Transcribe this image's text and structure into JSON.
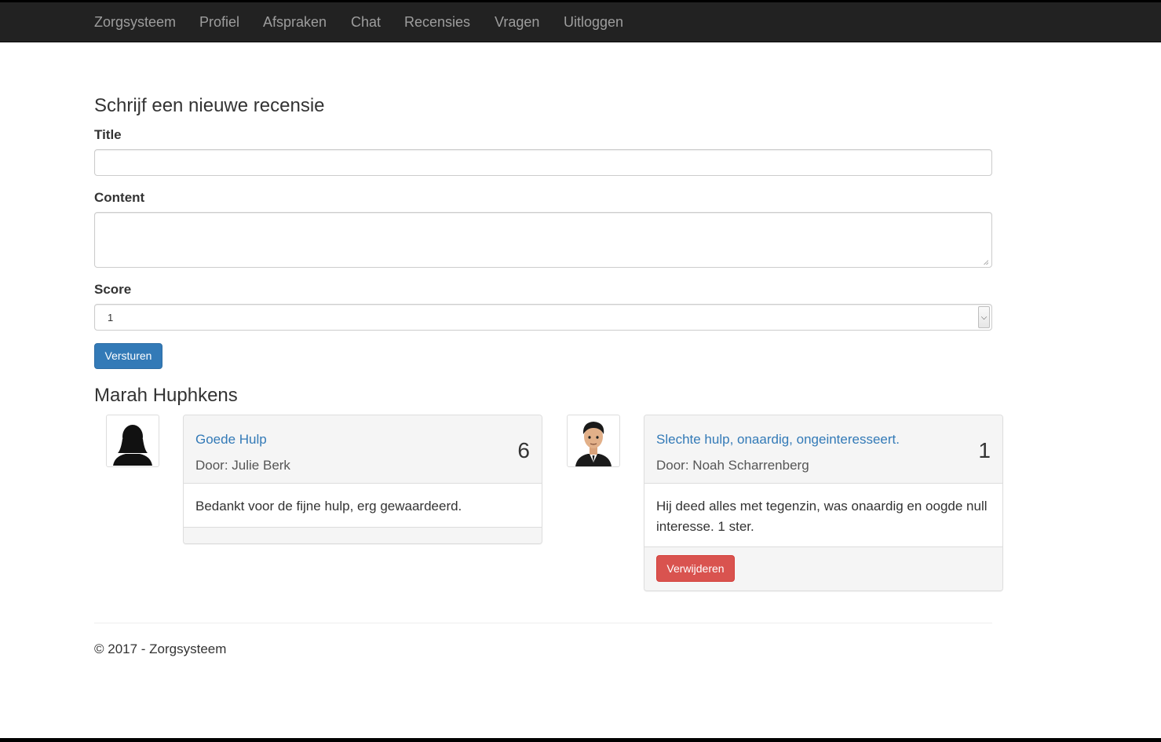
{
  "navbar": {
    "brand": "Zorgsysteem",
    "items": [
      "Profiel",
      "Afspraken",
      "Chat",
      "Recensies",
      "Vragen",
      "Uitloggen"
    ]
  },
  "form": {
    "heading": "Schrijf een nieuwe recensie",
    "title_label": "Title",
    "title_value": "",
    "content_label": "Content",
    "content_value": "",
    "score_label": "Score",
    "score_value": "1",
    "submit_label": "Versturen"
  },
  "person": {
    "name": "Marah Huphkens"
  },
  "reviews": [
    {
      "title": "Goede Hulp",
      "author": "Door: Julie Berk",
      "score": "6",
      "body": "Bedankt voor de fijne hulp, erg gewaardeerd.",
      "avatar": "female-silhouette-icon"
    },
    {
      "title": "Slechte hulp, onaardig, ongeinteresseert.",
      "author": "Door: Noah Scharrenberg",
      "score": "1",
      "body": "Hij deed alles met tegenzin, was onaardig en oogde null interesse. 1 ster.",
      "avatar": "cartoon-man-avatar",
      "delete_label": "Verwijderen"
    }
  ],
  "footer": {
    "text": "© 2017 - Zorgsysteem"
  },
  "colors": {
    "navbar": "#222222",
    "primary": "#337ab7",
    "danger": "#d9534f",
    "link": "#337ab7"
  }
}
